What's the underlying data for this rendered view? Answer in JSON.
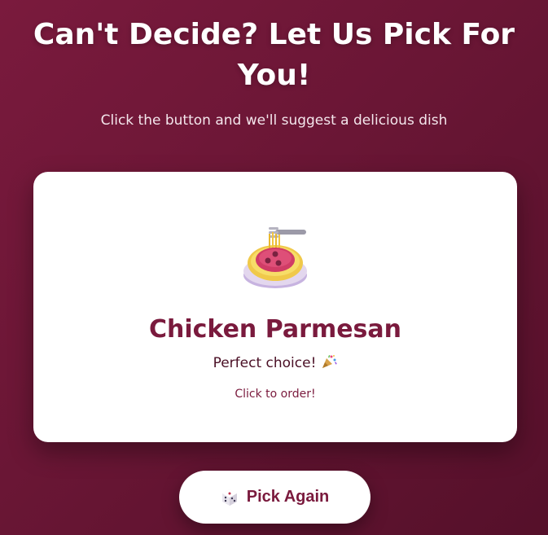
{
  "header": {
    "title_line1": "Can't Decide? Let Us Pick For",
    "title_line2": "You!",
    "subtitle": "Click the button and we'll suggest a delicious dish"
  },
  "result": {
    "icon": "spaghetti-icon",
    "dish_name": "Chicken Parmesan",
    "choice_text": "Perfect choice!",
    "choice_icon": "party-popper-icon",
    "order_link": "Click to order!"
  },
  "actions": {
    "pick_again_icon": "dice-icon",
    "pick_again_label": "Pick Again"
  },
  "colors": {
    "background": "#6a1635",
    "accent": "#7a1a3d",
    "card": "#ffffff"
  }
}
